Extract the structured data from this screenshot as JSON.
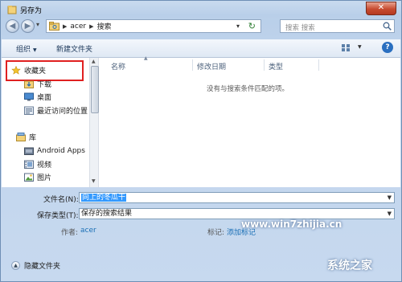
{
  "window": {
    "title": "另存为",
    "close_glyph": "✕"
  },
  "nav": {
    "back_glyph": "◀",
    "forward_glyph": "▶",
    "breadcrumb": [
      "acer",
      "搜索"
    ],
    "refresh_glyph": "↻",
    "search_placeholder": "搜索 搜索"
  },
  "toolbar": {
    "organize": "组织",
    "new_folder": "新建文件夹"
  },
  "sidebar": {
    "favorites": "收藏夹",
    "downloads": "下载",
    "desktop": "桌面",
    "recent": "最近访问的位置",
    "libraries": "库",
    "android_apps": "Android Apps",
    "videos": "视频",
    "pictures": "图片"
  },
  "filelist": {
    "columns": [
      "名称",
      "修改日期",
      "类型"
    ],
    "empty_message": "没有与搜索条件匹配的项。"
  },
  "form": {
    "filename_label": "文件名(N):",
    "filename_value": "向上的冬瓜干",
    "filetype_label": "保存类型(T):",
    "filetype_value": "保存的搜索结果",
    "author_label": "作者:",
    "author_value": "acer",
    "tags_label": "标记:",
    "tags_value": "添加标记"
  },
  "footer": {
    "hide_folders": "隐藏文件夹"
  },
  "watermark": {
    "url": "www.win7zhijia.cn",
    "brand": "系统之家"
  },
  "colors": {
    "accent": "#3399ff",
    "highlight_box": "#e02020",
    "link": "#1a6fb5"
  }
}
